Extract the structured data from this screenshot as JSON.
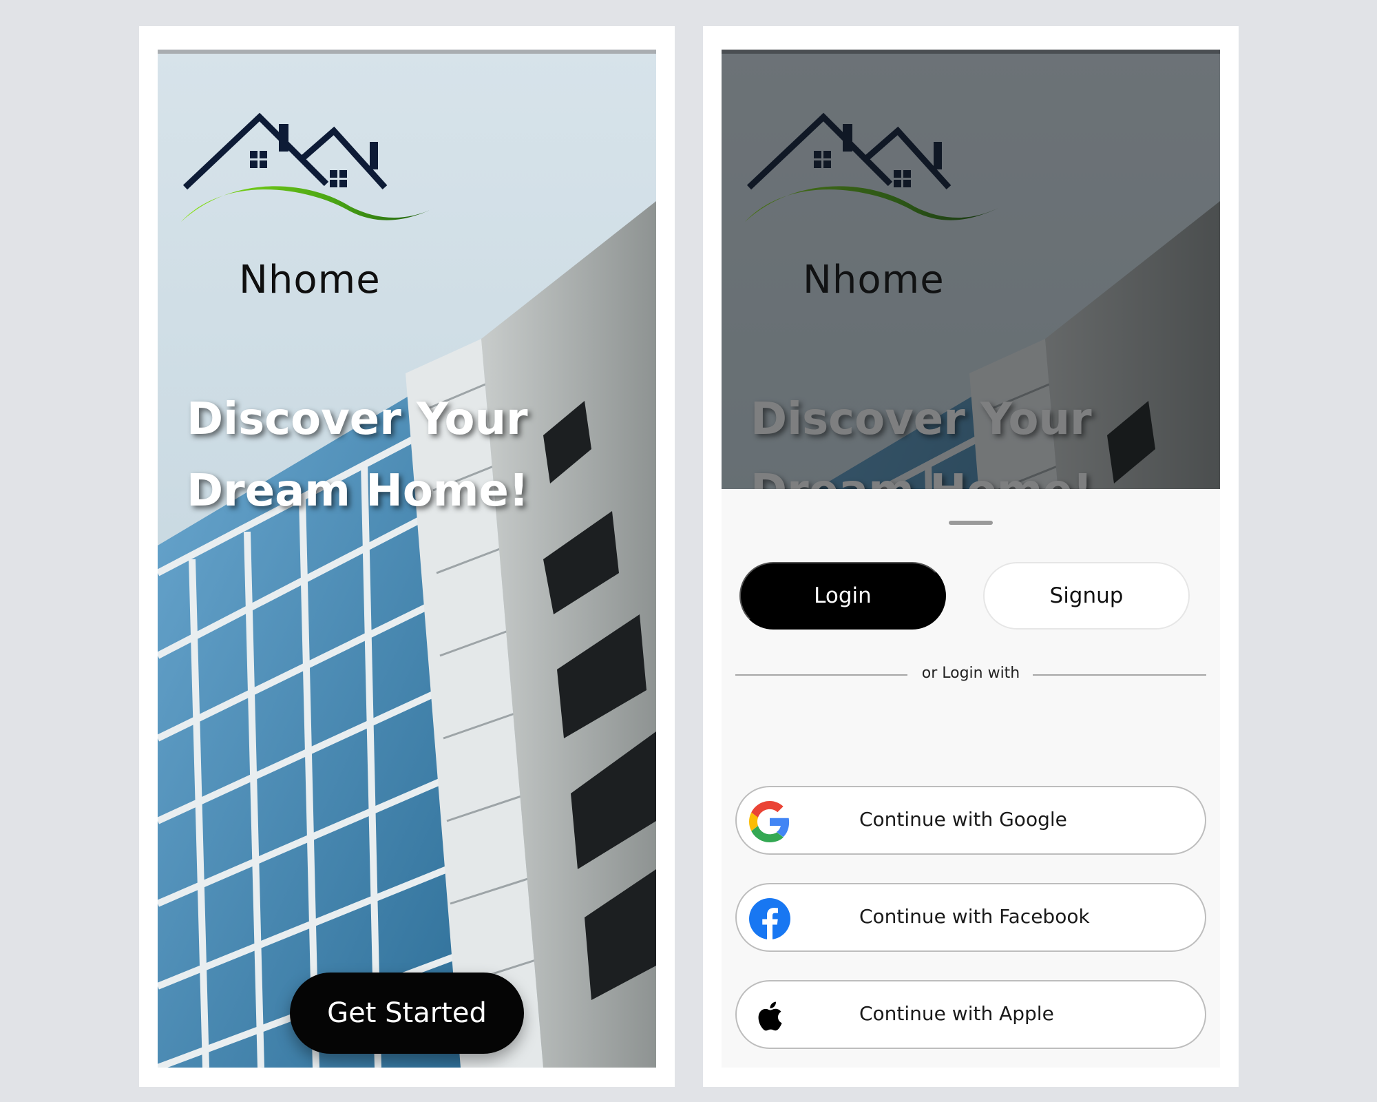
{
  "brand": {
    "name": "Nhome"
  },
  "hero": {
    "line1": "Discover Your",
    "line2": "Dream Home!"
  },
  "welcome": {
    "cta_label": "Get Started"
  },
  "auth": {
    "login_label": "Login",
    "signup_label": "Signup",
    "divider_text": "or Login with",
    "google_label": "Continue with Google",
    "facebook_label": "Continue with Facebook",
    "apple_label": "Continue with Apple"
  },
  "colors": {
    "page_bg": "#e1e3e7",
    "primary_button": "#000000",
    "logo_navy": "#0d1b36",
    "logo_green": "#5fbf16"
  },
  "icons": [
    "house-logo-icon",
    "google-icon",
    "facebook-icon",
    "apple-icon"
  ]
}
